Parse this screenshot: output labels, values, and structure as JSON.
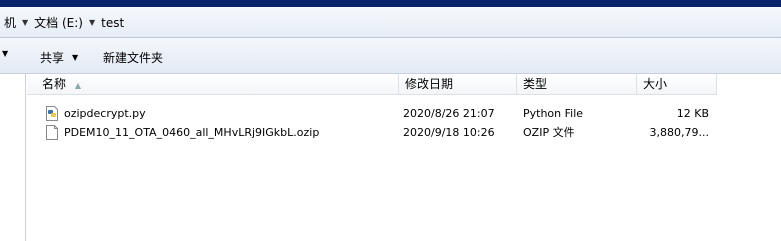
{
  "address": {
    "crumbs": [
      {
        "label": "机"
      },
      {
        "label": "文档 (E:)"
      },
      {
        "label": "test"
      }
    ]
  },
  "toolbar": {
    "first_label": "",
    "share_label": "共享",
    "new_folder_label": "新建文件夹"
  },
  "columns": {
    "name": "名称",
    "modified": "修改日期",
    "type": "类型",
    "size": "大小"
  },
  "files": [
    {
      "name": "ozipdecrypt.py",
      "modified": "2020/8/26 21:07",
      "type": "Python File",
      "size": "12 KB",
      "icon": "python-file-icon"
    },
    {
      "name": "PDEM10_11_OTA_0460_all_MHvLRj9IGkbL.ozip",
      "modified": "2020/9/18 10:26",
      "type": "OZIP 文件",
      "size": "3,880,79...",
      "icon": "generic-file-icon"
    }
  ]
}
